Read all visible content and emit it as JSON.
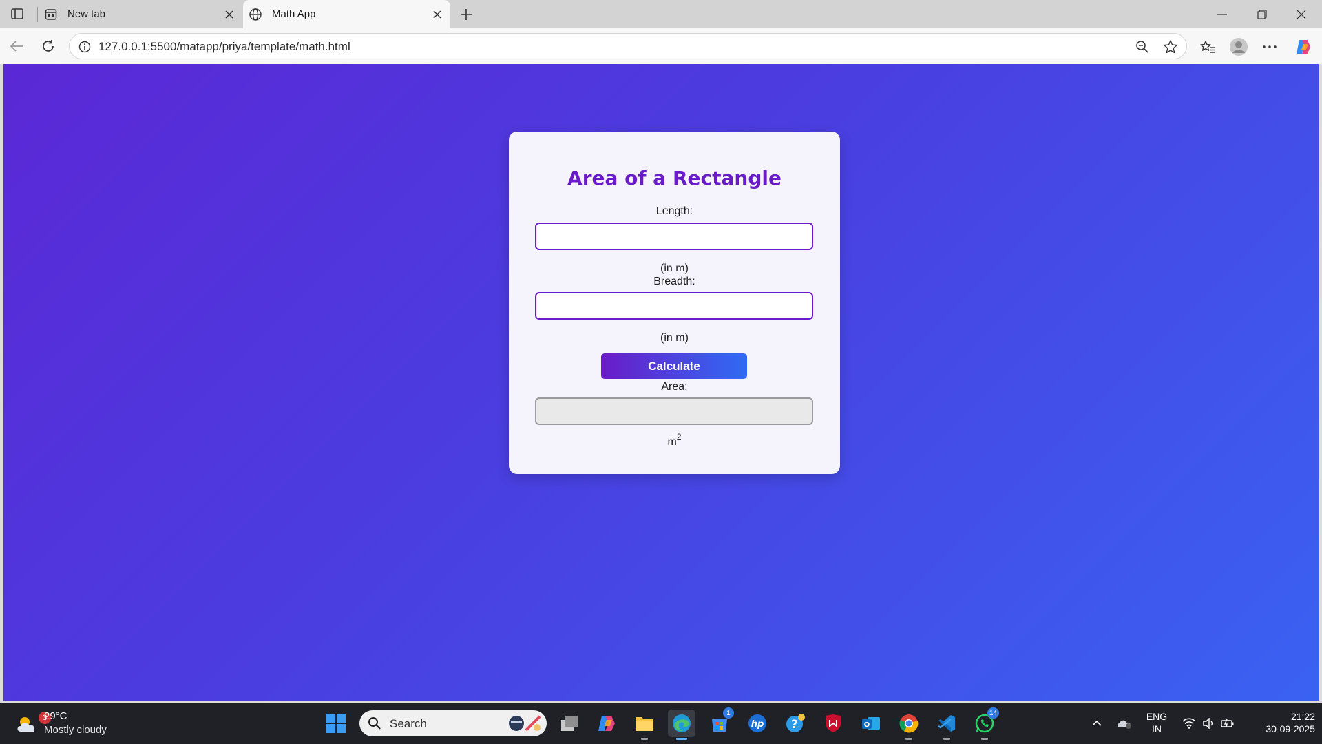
{
  "browser": {
    "tabs": [
      {
        "title": "New tab",
        "active": false
      },
      {
        "title": "Math App",
        "active": true
      }
    ],
    "address": "127.0.0.1:5500/matapp/priya/template/math.html"
  },
  "app": {
    "title": "Area of a Rectangle",
    "length_label": "Length:",
    "length_value": "",
    "length_unit": "(in m)",
    "breadth_label": "Breadth:",
    "breadth_value": "",
    "breadth_unit": "(in m)",
    "calculate_label": "Calculate",
    "area_label": "Area:",
    "area_value": "",
    "area_unit_base": "m",
    "area_unit_exp": "2",
    "colors": {
      "accent": "#6a1bc8",
      "gradient_start": "#5b28d6",
      "gradient_end": "#3a62f2"
    }
  },
  "taskbar": {
    "weather": {
      "temp": "29°C",
      "desc": "Mostly cloudy",
      "badge": "3"
    },
    "search_label": "Search",
    "badges": {
      "store": "1",
      "whatsapp": "14"
    },
    "language": {
      "line1": "ENG",
      "line2": "IN"
    },
    "clock": {
      "time": "21:22",
      "date": "30-09-2025"
    }
  }
}
